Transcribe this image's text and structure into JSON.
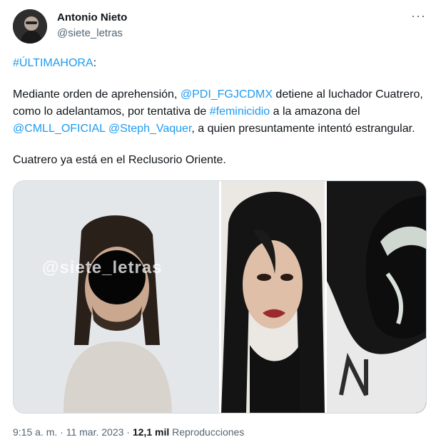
{
  "author": {
    "name": "Antonio Nieto",
    "handle": "@siete_letras"
  },
  "more_icon": "more-horizontal-icon",
  "tweet": {
    "hashtag_top": "#ÚLTIMAHORA",
    "hashtag_top_suffix": ":",
    "p2_a": "Mediante orden de aprehensión, ",
    "mention_pdi": "@PDI_FGJCDMX",
    "p2_b": " detiene al luchador Cuatrero, como lo adelantamos, por tentativa de ",
    "hashtag_feminicidio": "#feminicidio",
    "p2_c": " a la amazona del ",
    "mention_cmll": "@CMLL_OFICIAL",
    "p2_d": " ",
    "mention_steph": "@Steph_Vaquer",
    "p2_e": ", a quien presuntamente intentó estrangular.",
    "p3": "Cuatrero ya está en el Reclusorio Oriente."
  },
  "media": {
    "watermark": "@siete_letras"
  },
  "meta": {
    "time": "9:15 a. m.",
    "separator": " · ",
    "date": "11 mar. 2023",
    "separator2": " · ",
    "views": "12,1 mil",
    "views_label": " Reproducciones"
  }
}
